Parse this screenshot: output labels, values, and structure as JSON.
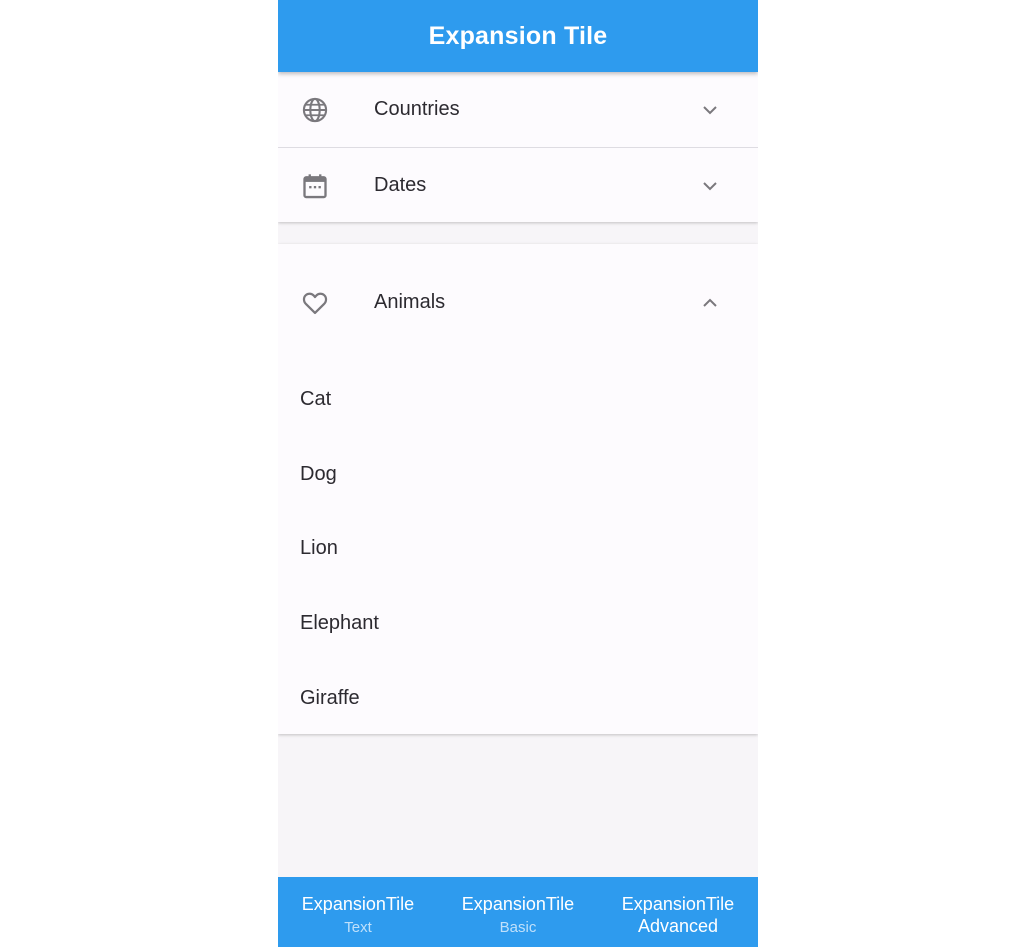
{
  "appbar": {
    "title": "Expansion Tile"
  },
  "tiles": [
    {
      "label": "Countries",
      "icon": "globe-icon",
      "expanded": false
    },
    {
      "label": "Dates",
      "icon": "calendar-icon",
      "expanded": false
    },
    {
      "label": "Animals",
      "icon": "heart-outline-icon",
      "expanded": true,
      "children": [
        "Cat",
        "Dog",
        "Lion",
        "Elephant",
        "Giraffe"
      ]
    }
  ],
  "bottom_nav": [
    {
      "title": "ExpansionTile",
      "subtitle": "Text"
    },
    {
      "title": "ExpansionTile",
      "subtitle": "Basic"
    },
    {
      "title": "ExpansionTile",
      "subtitle": "Advanced"
    }
  ],
  "colors": {
    "primary": "#2e9bee",
    "card_background": "#fdfbfe",
    "page_background": "#f7f5f8",
    "icon": "#7a787d"
  }
}
